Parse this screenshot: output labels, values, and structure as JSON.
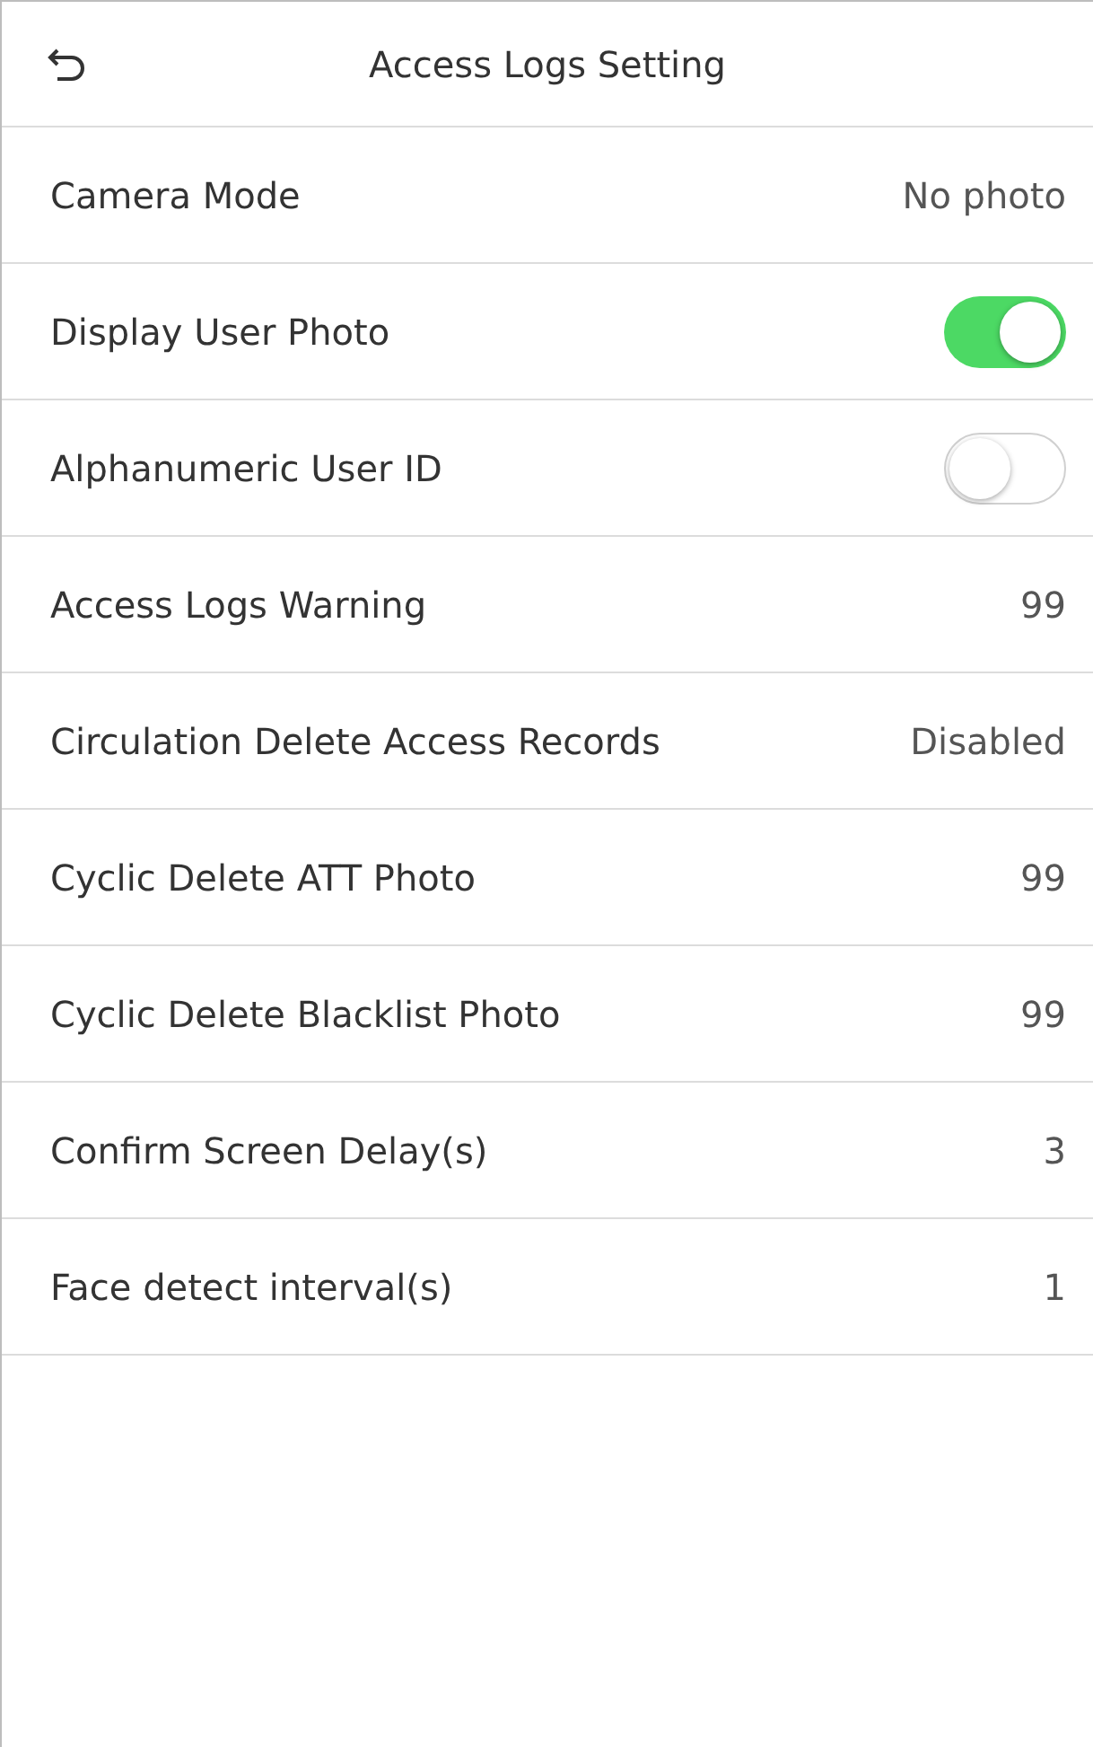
{
  "header": {
    "title": "Access Logs Setting"
  },
  "rows": [
    {
      "kind": "value",
      "label": "Camera Mode",
      "value": "No photo"
    },
    {
      "kind": "toggle",
      "label": "Display User Photo",
      "on": true
    },
    {
      "kind": "toggle",
      "label": "Alphanumeric User ID",
      "on": false
    },
    {
      "kind": "value",
      "label": "Access Logs Warning",
      "value": "99"
    },
    {
      "kind": "value",
      "label": "Circulation Delete Access Records",
      "value": "Disabled"
    },
    {
      "kind": "value",
      "label": "Cyclic Delete ATT Photo",
      "value": "99"
    },
    {
      "kind": "value",
      "label": "Cyclic Delete Blacklist Photo",
      "value": "99"
    },
    {
      "kind": "value",
      "label": "Confirm Screen Delay(s)",
      "value": "3"
    },
    {
      "kind": "value",
      "label": "Face detect interval(s)",
      "value": "1"
    }
  ]
}
